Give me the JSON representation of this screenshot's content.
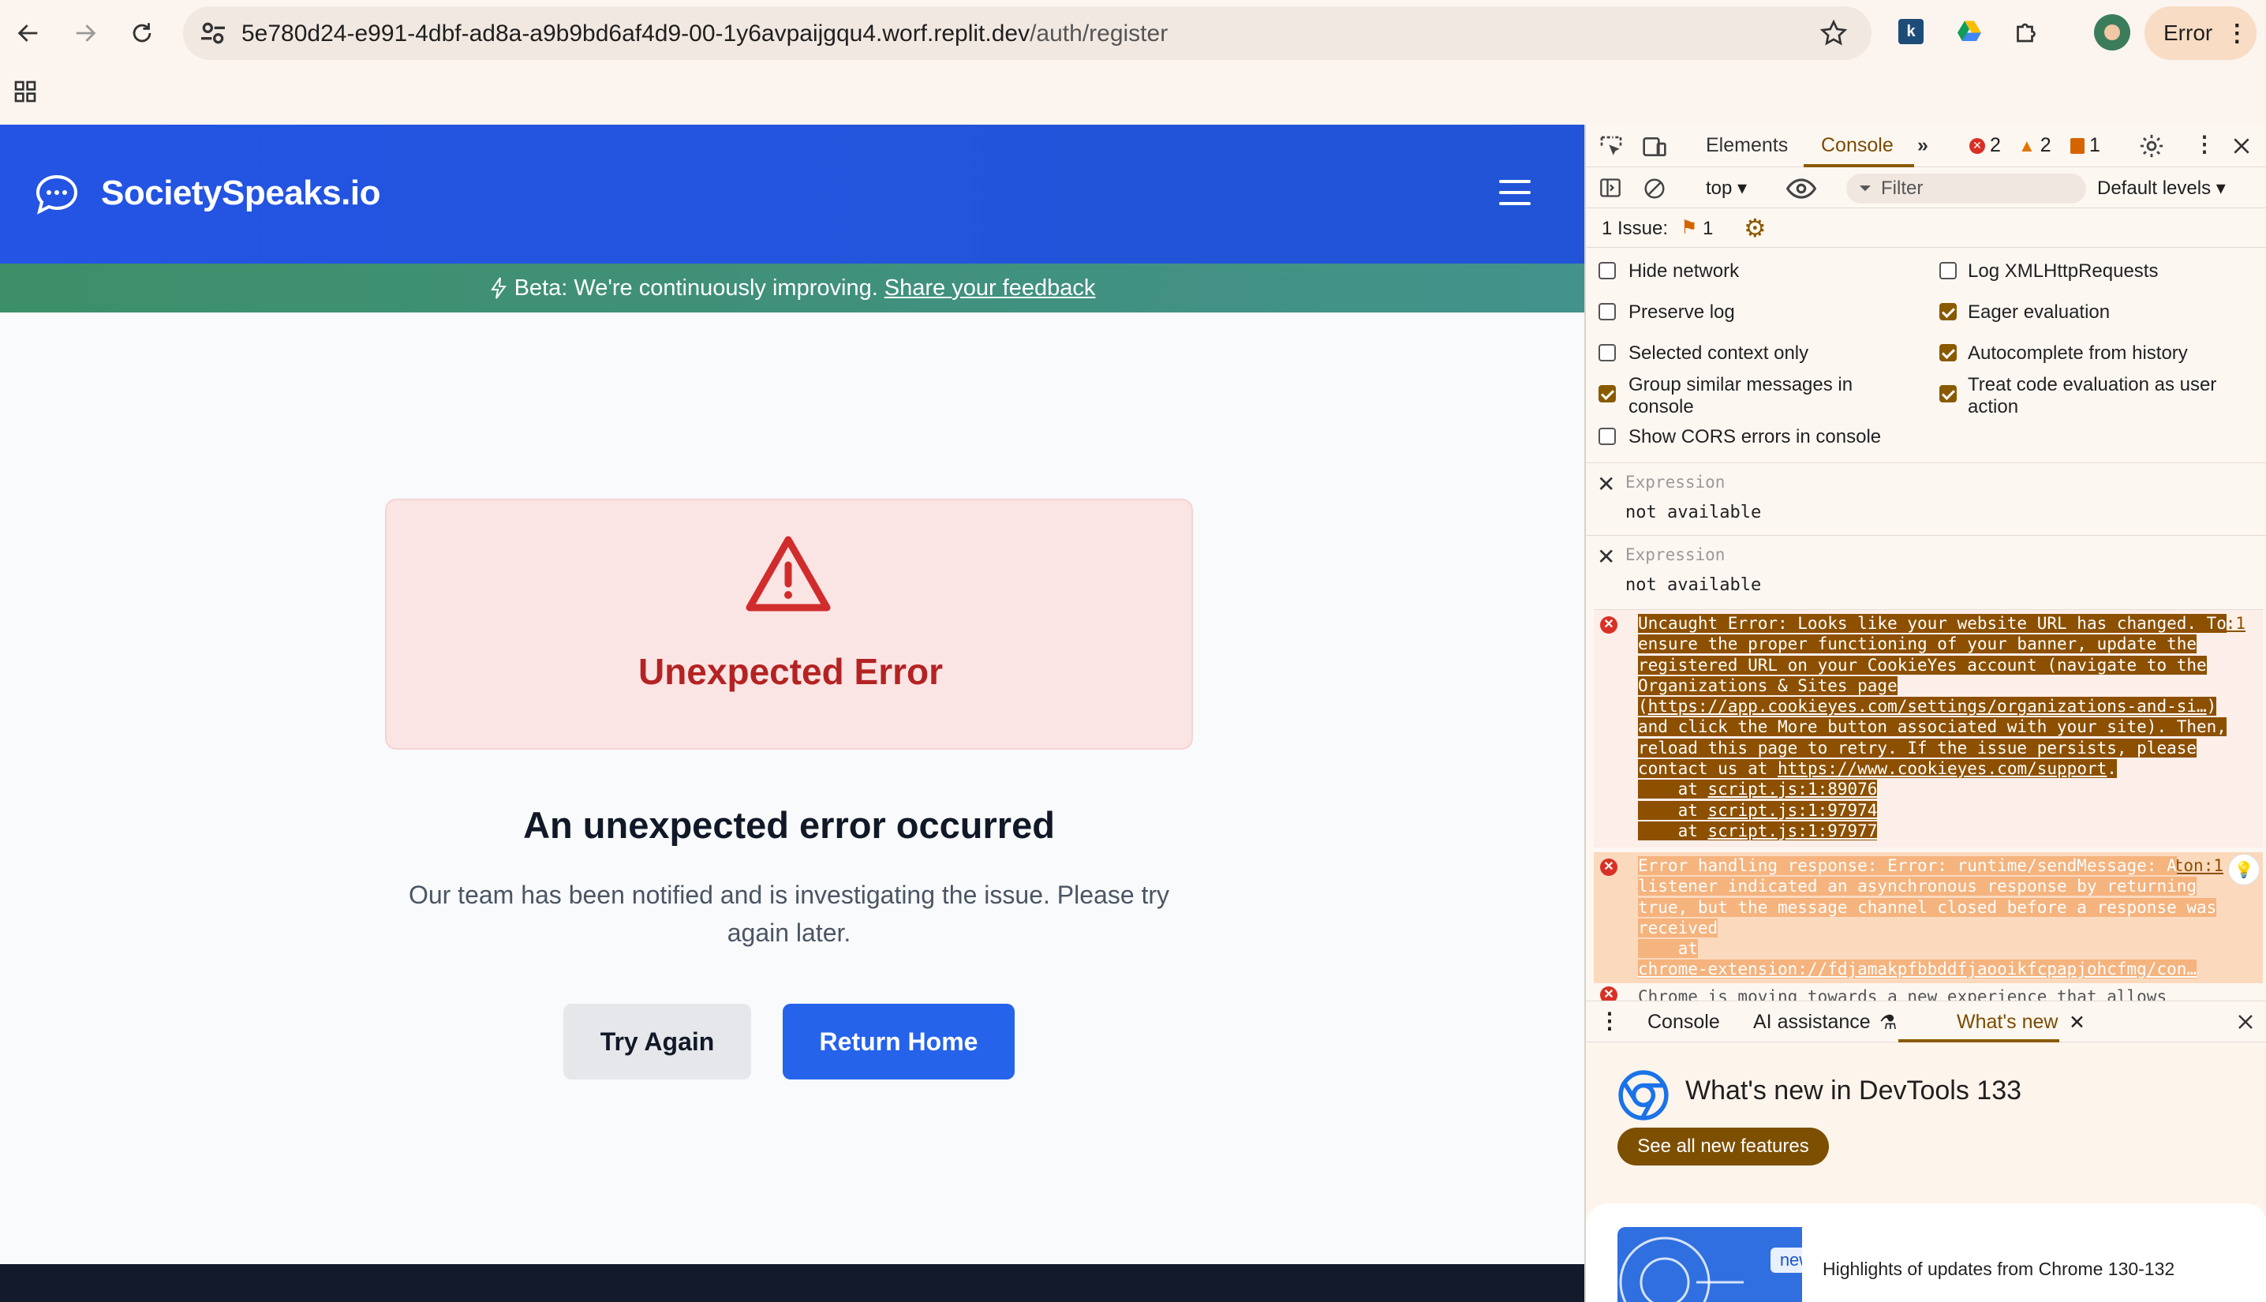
{
  "browser": {
    "url_host": "5e780d24-e991-4dbf-ad8a-a9b9bd6af4d9-00-1y6avpaijgqu4.worf.replit.dev",
    "url_path": "/auth/register",
    "error_pill": "Error"
  },
  "site": {
    "brand": "SocietySpeaks.io",
    "beta_text": "Beta: We're continuously improving.",
    "beta_link": "Share your feedback",
    "error_card_title": "Unexpected Error",
    "subheading": "An unexpected error occurred",
    "description": "Our team has been notified and is investigating the issue. Please try again later.",
    "try_again": "Try Again",
    "return_home": "Return Home"
  },
  "devtools": {
    "tabs": {
      "elements": "Elements",
      "console": "Console"
    },
    "counts": {
      "errors": "2",
      "warnings": "2",
      "issues": "1"
    },
    "toolbar": {
      "context": "top",
      "filter_placeholder": "Filter",
      "levels": "Default levels"
    },
    "issues_label": "1 Issue:",
    "issues_count": "1",
    "options_left": [
      "Hide network",
      "Preserve log",
      "Selected context only",
      "Group similar messages in console",
      "Show CORS errors in console"
    ],
    "options_right": [
      "Log XMLHttpRequests",
      "Eager evaluation",
      "Autocomplete from history",
      "Treat code evaluation as user action"
    ],
    "expressions": [
      {
        "label": "Expression",
        "value": "not available"
      },
      {
        "label": "Expression",
        "value": "not available"
      }
    ],
    "messages": [
      {
        "source": "script.js:1",
        "text_1": "Uncaught Error: Looks like your website URL has changed. To ensure the proper functioning of your banner, update the registered URL on your CookieYes account (navigate to the Organizations & Sites page (",
        "link_1": "https://app.cookieyes.com/settings/organizations-and-si…",
        "text_2": ") and click the More button associated with your site). Then, reload this page to retry. If the issue persists, please contact us at",
        "link_2": "https://www.cookieyes.com/support",
        "text_3": ".",
        "stack": [
          "script.js:1:89076",
          "script.js:1:97974",
          "script.js:1:97977"
        ]
      },
      {
        "source": "button:1",
        "text": "Error handling response: Error: runtime/sendMessage: A listener indicated an asynchronous response by returning true, but the message channel closed before a response was received",
        "link": "chrome-extension://fdjamakpfbbddfjaooikfcpapjohcfmg/con…"
      }
    ],
    "partial_message": "Chrome is moving towards a new experience that allows",
    "drawer": {
      "tabs": [
        "Console",
        "AI assistance",
        "What's new"
      ],
      "title": "What's new in DevTools 133",
      "see_all": "See all new features",
      "badge": "new",
      "highlight": "Highlights of updates from Chrome 130-132"
    }
  },
  "colors": {
    "header_blue": "#2354e4",
    "error_red": "#b42323",
    "primary_button": "#2563eb",
    "devtools_accent": "#8a5a00"
  }
}
